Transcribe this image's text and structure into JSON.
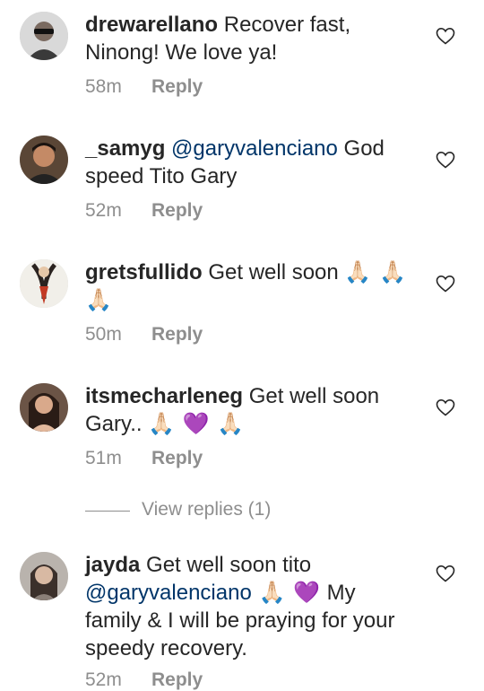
{
  "comments": [
    {
      "username": "drewarellano",
      "mention": "",
      "text": " Recover fast, Ninong! We love ya!",
      "emojis": "",
      "text2": "",
      "time": "58m",
      "reply_label": "Reply",
      "avatar_icon": "user-avatar-sunglasses",
      "like_icon": "heart-outline-icon"
    },
    {
      "username": "_samyg",
      "mention": " @garyvalenciano",
      "text": " God speed Tito Gary",
      "emojis": "",
      "text2": "",
      "time": "52m",
      "reply_label": "Reply",
      "avatar_icon": "user-avatar-portrait",
      "like_icon": "heart-outline-icon"
    },
    {
      "username": "gretsfullido",
      "mention": "",
      "text": " Get well soon ",
      "emojis": "🙏🏻 🙏🏻 🙏🏻 ",
      "text2": "",
      "time": "50m",
      "reply_label": "Reply",
      "avatar_icon": "user-avatar-drawing",
      "like_icon": "heart-outline-icon"
    },
    {
      "username": "itsmecharleneg",
      "mention": "",
      "text": " Get well soon Gary.. ",
      "emojis": "🙏🏻 💜 🙏🏻 ",
      "text2": "",
      "time": "51m",
      "reply_label": "Reply",
      "avatar_icon": "user-avatar-woman",
      "like_icon": "heart-outline-icon"
    },
    {
      "username": "jayda",
      "mention": "",
      "text": " Get well soon tito ",
      "mention2": "@garyvalenciano",
      "emojis": " 🙏🏻 💜",
      "text2": " My family & I will be praying for your speedy recovery.",
      "time": "52m",
      "reply_label": "Reply",
      "avatar_icon": "user-avatar-girl",
      "like_icon": "heart-outline-icon"
    }
  ],
  "view_replies_label": "View replies (1)",
  "colors": {
    "text": "#262626",
    "muted": "#8e8e8e",
    "mention": "#003569",
    "background": "#ffffff"
  }
}
